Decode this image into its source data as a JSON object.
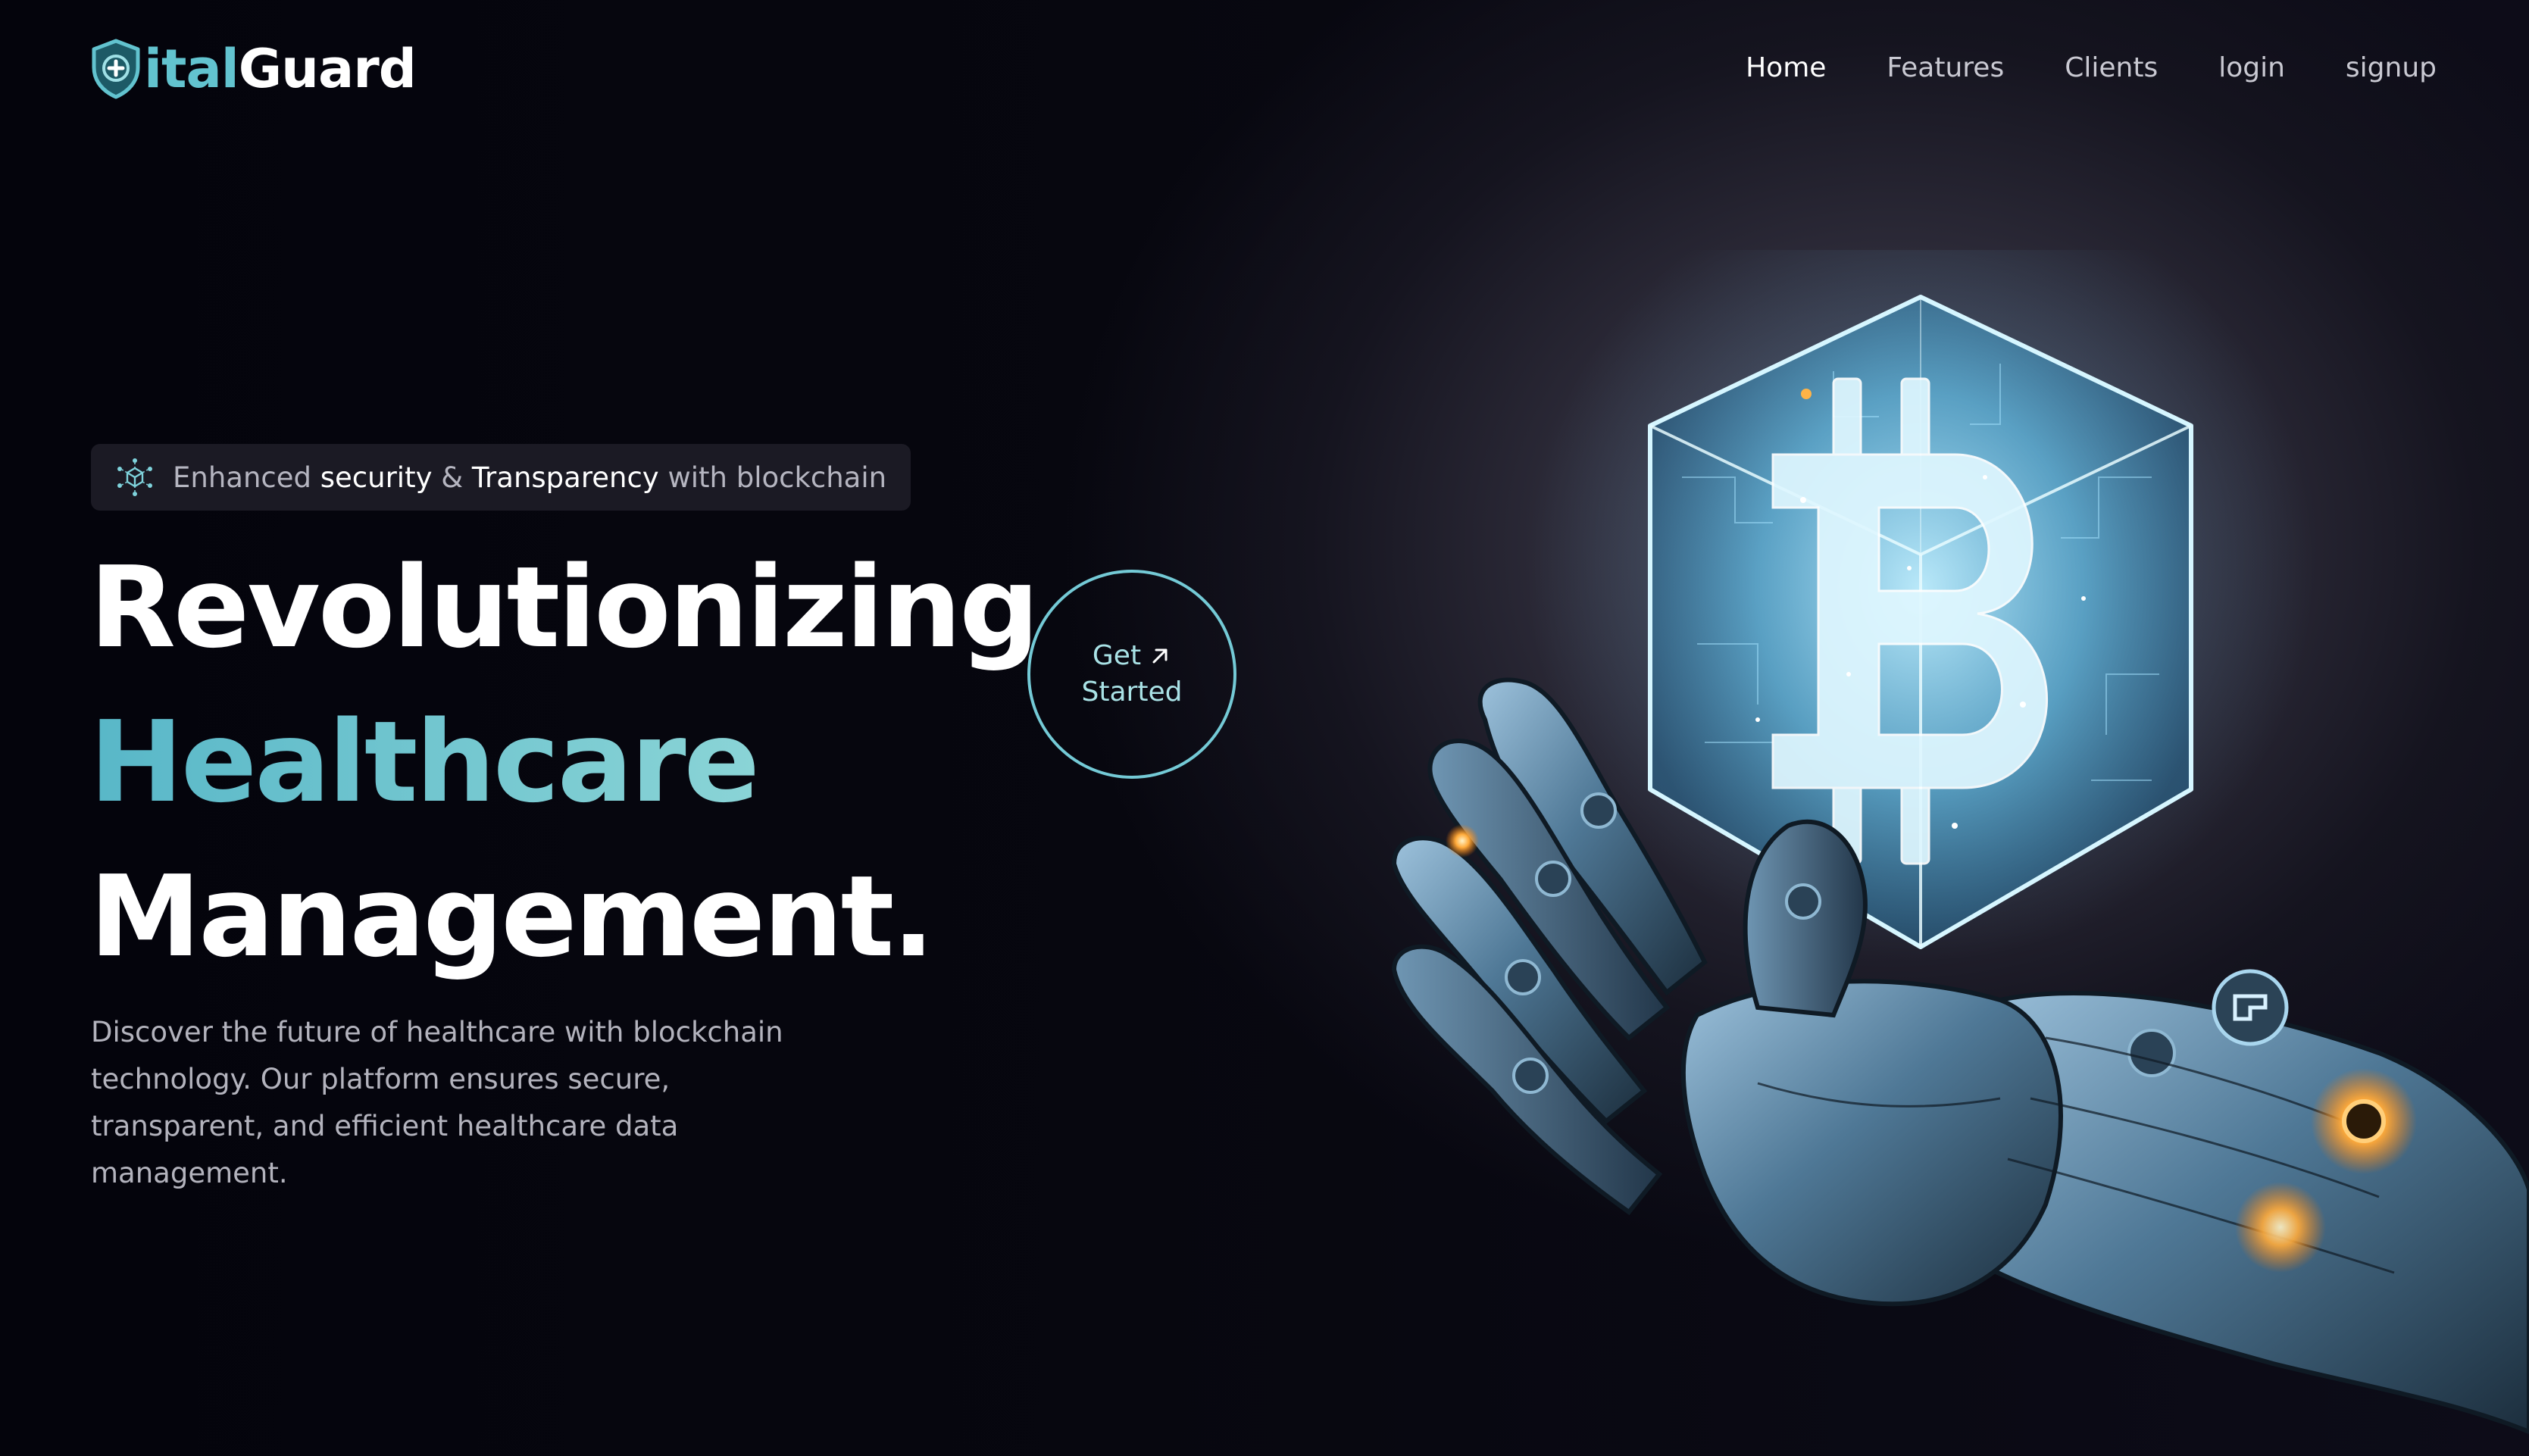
{
  "brand": {
    "logo_prefix": "ital",
    "logo_suffix": "Guard",
    "logo_icon": "shield-plus-icon",
    "accent": "#62c3cf"
  },
  "nav": {
    "items": [
      {
        "label": "Home",
        "active": true
      },
      {
        "label": "Features",
        "active": false
      },
      {
        "label": "Clients",
        "active": false
      },
      {
        "label": "login",
        "active": false
      },
      {
        "label": "signup",
        "active": false
      }
    ]
  },
  "badge": {
    "icon": "blockchain-cube-icon",
    "text_1": "Enhanced",
    "highlight_1": "security",
    "text_2": "&",
    "highlight_2": "Transparency",
    "text_3": "with blockchain"
  },
  "hero": {
    "line_1": "Revolutionizing",
    "line_2": "Healthcare",
    "line_3": "Management.",
    "description": "Discover the future of healthcare with blockchain technology. Our platform ensures secure, transparent, and efficient healthcare data management.",
    "cta_line_1": "Get",
    "cta_line_2": "Started",
    "cta_icon": "arrow-up-right-icon",
    "image": "robotic-hand-holding-bitcoin-cube-illustration"
  },
  "colors": {
    "background": "#07070f",
    "heading": "#ffffff",
    "gradient_start": "#58b7c8",
    "gradient_end": "#9fe0dc",
    "body_text": "#b3b3bd"
  }
}
